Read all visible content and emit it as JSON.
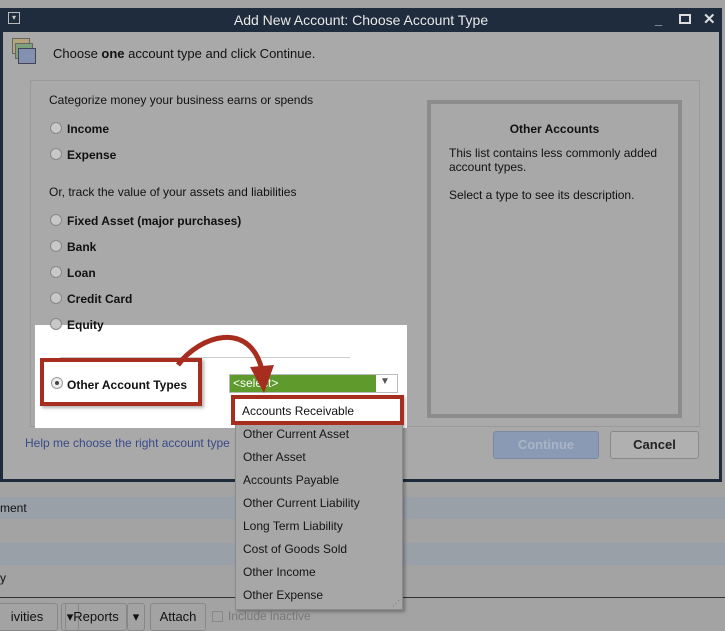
{
  "window": {
    "title": "Add New Account: Choose Account Type"
  },
  "header": {
    "prefix": "Choose ",
    "bold": "one",
    "suffix": " account type and click Continue."
  },
  "sections": {
    "earn_spend": "Categorize money your business earns or spends",
    "assets": "Or, track the value of your assets and liabilities"
  },
  "options": [
    {
      "label": "Income",
      "selected": false
    },
    {
      "label": "Expense",
      "selected": false
    },
    {
      "label": "Fixed Asset (major purchases)",
      "selected": false
    },
    {
      "label": "Bank",
      "selected": false
    },
    {
      "label": "Loan",
      "selected": false
    },
    {
      "label": "Credit Card",
      "selected": false
    },
    {
      "label": "Equity",
      "selected": false
    },
    {
      "label": "Other Account Types",
      "selected": true
    }
  ],
  "select": {
    "value": "<select>",
    "color": "#5e9a2c"
  },
  "dropdown_items": [
    "Accounts Receivable",
    "Other Current Asset",
    "Other Asset",
    "Accounts Payable",
    "Other Current Liability",
    "Long Term Liability",
    "Cost of Goods Sold",
    "Other Income",
    "Other Expense"
  ],
  "description": {
    "title": "Other Accounts",
    "line1": "This list contains less commonly added account types.",
    "line2": "Select a type to see its description."
  },
  "help_link": "Help me choose the right account type",
  "buttons": {
    "continue": "Continue",
    "cancel": "Cancel"
  },
  "background": {
    "row1": "ment",
    "row2": "y",
    "activities": "ivities",
    "reports": "Reports",
    "attach": "Attach",
    "include_inactive": "Include inactive"
  },
  "annotation_color": "#a72d1e"
}
